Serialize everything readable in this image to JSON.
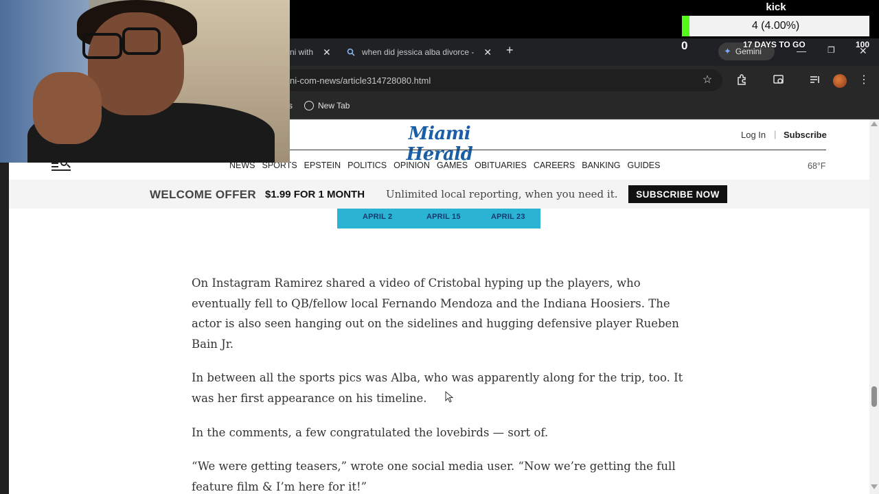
{
  "browser": {
    "tabs": [
      {
        "title": "ni with",
        "close": "✕"
      },
      {
        "title": "when did jessica alba divorce -",
        "close": "✕"
      }
    ],
    "new_tab_symbol": "+",
    "gemini_label": "Gemini",
    "window_controls": {
      "minimize": "—",
      "restore": "❐",
      "close": "✕"
    },
    "url": "ni-com-news/article314728080.html",
    "bookmarks": [
      {
        "label": "s"
      },
      {
        "label": "New Tab"
      }
    ],
    "icons": [
      "star-icon",
      "extensions-icon",
      "lens-icon",
      "media-icon",
      "profile-avatar",
      "more-icon"
    ]
  },
  "site": {
    "logo": "Miami Herald",
    "login": "Log In",
    "separator": "|",
    "subscribe": "Subscribe",
    "nav": [
      "NEWS",
      "SPORTS",
      "EPSTEIN",
      "POLITICS",
      "OPINION",
      "GAMES",
      "OBITUARIES",
      "CAREERS",
      "BANKING",
      "GUIDES"
    ],
    "temperature": "68°F"
  },
  "offer": {
    "title": "WELCOME OFFER",
    "price": "$1.99 FOR 1 MONTH",
    "description": "Unlimited local reporting, when you need it.",
    "button": "SUBSCRIBE NOW"
  },
  "ad": {
    "dates": [
      "APRIL 2",
      "APRIL 15",
      "APRIL 23"
    ],
    "color": "#2bb3d4"
  },
  "article": {
    "paragraphs": [
      "On Instagram Ramirez shared a video of Cristobal hyping up the players, who eventually fell to QB/fellow local Fernando Mendoza and the Indiana Hoosiers. The actor is also seen hanging out on the sidelines and hugging defensive player Rueben Bain Jr.",
      "In between all the sports pics was Alba, who was apparently along for the trip, too. It was her first appearance on his timeline.",
      "In the comments, a few congratulated the lovebirds — sort of.",
      "“We were getting teasers,” wrote one social media user. “Now we’re getting the full feature film & I’m here for it!”"
    ]
  },
  "overlay": {
    "goal_label": "kick",
    "goal_text": "4 (4.00%)",
    "goal_fraction": 0.04,
    "goal_min": "0",
    "goal_days": "17 DAYS TO GO",
    "goal_max": "100",
    "accent": "#53fc18"
  },
  "scroll": {
    "fraction": 0.72
  }
}
